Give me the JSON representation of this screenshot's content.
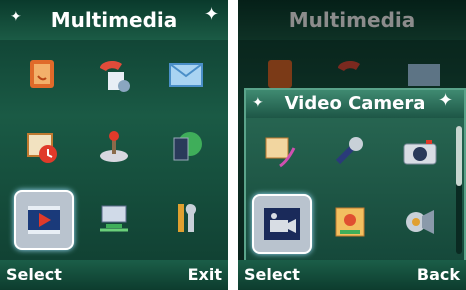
{
  "left_screen": {
    "title": "Multimedia",
    "items": [
      {
        "icon": "phonebook-icon"
      },
      {
        "icon": "call-log-icon"
      },
      {
        "icon": "messages-icon"
      },
      {
        "icon": "organizer-icon"
      },
      {
        "icon": "games-icon"
      },
      {
        "icon": "browser-icon"
      },
      {
        "icon": "multimedia-player-icon"
      },
      {
        "icon": "connectivity-icon"
      },
      {
        "icon": "settings-icon"
      }
    ],
    "selected_index": 6,
    "softkeys": {
      "left": "Select",
      "right": "Exit"
    }
  },
  "right_screen": {
    "background_title": "Multimedia",
    "popup_title": "Video Camera",
    "items": [
      {
        "icon": "image-viewer-icon"
      },
      {
        "icon": "voice-recorder-icon"
      },
      {
        "icon": "camera-icon"
      },
      {
        "icon": "video-camera-icon"
      },
      {
        "icon": "photo-album-icon"
      },
      {
        "icon": "music-player-icon"
      }
    ],
    "selected_index": 3,
    "softkeys": {
      "left": "Select",
      "right": "Back"
    }
  },
  "colors": {
    "background": "#1a5a45",
    "accent": "#9fe0ff",
    "text": "#ffffff"
  }
}
